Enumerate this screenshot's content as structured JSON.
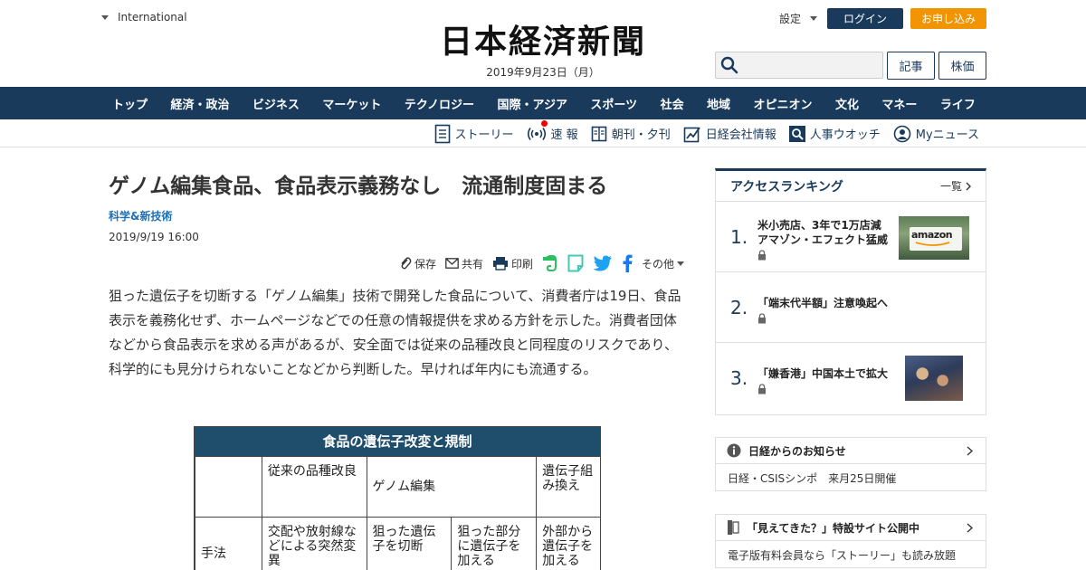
{
  "header": {
    "intl_label": "International",
    "logo_text": "日本経済新聞",
    "date": "2019年9月23日（月）",
    "settings_label": "設定",
    "login_label": "ログイン",
    "signup_label": "お申し込み",
    "search_placeholder": "",
    "articles_label": "記事",
    "stocks_label": "株価"
  },
  "nav": {
    "items": [
      "トップ",
      "経済・政治",
      "ビジネス",
      "マーケット",
      "テクノロジー",
      "国際・アジア",
      "スポーツ",
      "社会",
      "地域",
      "オピニオン",
      "文化",
      "マネー",
      "ライフ"
    ]
  },
  "subnav": {
    "story": "ストーリー",
    "breaking": "速 報",
    "paper": "朝刊・夕刊",
    "company": "日経会社情報",
    "personnel": "人事ウオッチ",
    "mynews": "Myニュース"
  },
  "article": {
    "headline": "ゲノム編集食品、食品表示義務なし　流通制度固まる",
    "category": "科学&新技術",
    "date": "2019/9/19 16:00",
    "share": {
      "save": "保存",
      "share": "共有",
      "print": "印刷",
      "more": "その他"
    },
    "body": "狙った遺伝子を切断する「ゲノム編集」技術で開発した食品について、消費者庁は19日、食品表示を義務化せず、ホームページなどでの任意の情報提供を求める方針を示した。消費者団体などから食品表示を求める声があるが、安全面では従来の品種改良と同程度のリスクであり、科学的にも見分けられないことなどから判断した。早ければ年内にも流通する。",
    "figure": {
      "title": "食品の遺伝子改変と規制",
      "col1": "従来の品種改良",
      "col2": "ゲノム編集",
      "col3": "遺伝子組み換え",
      "row_label": "手法",
      "cell1": "交配や放射線などによる突然変異",
      "cell2a": "狙った遺伝子を切断",
      "cell2b": "狙った部分に遺伝子を加える",
      "cell3": "外部から遺伝子を加える"
    }
  },
  "ranking": {
    "title": "アクセスランキング",
    "more": "一覧",
    "items": [
      {
        "num": "1.",
        "title": "米小売店、3年で1万店減　アマゾン・エフェクト猛威"
      },
      {
        "num": "2.",
        "title": "「端末代半額」注意喚起へ"
      },
      {
        "num": "3.",
        "title": "「嫌香港」中国本土で拡大"
      }
    ],
    "thumb1_text": "amazon"
  },
  "notices": [
    {
      "title": "日経からのお知らせ",
      "text": "日経・CSISシンポ　来月25日開催"
    },
    {
      "title": "「見えてきた？」特設サイト公開中",
      "text": "電子版有料会員なら「ストーリー」も読み放題"
    }
  ]
}
